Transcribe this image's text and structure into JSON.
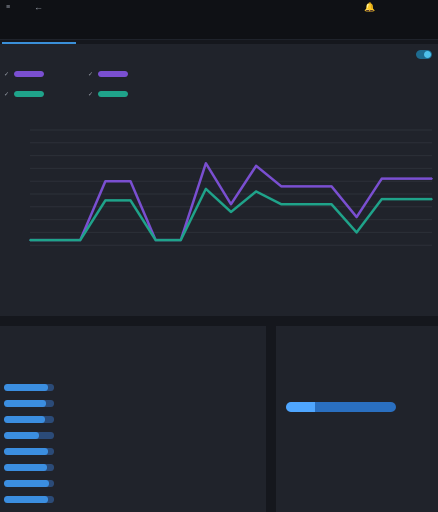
{
  "topbar": {
    "menu_text": "≡",
    "back_text": "←",
    "bell_text": "🔔",
    "right_line1": "",
    "right_line2": "",
    "bell_color": "#9aa0aa"
  },
  "tabs": {
    "active_label": ""
  },
  "chart_section": {
    "legend": {
      "col1_header": "",
      "col2_header": "",
      "toggle_label": ""
    },
    "footnote": ""
  },
  "chart_data": {
    "type": "line",
    "title": "",
    "x": [
      "",
      "",
      "",
      "",
      "",
      "",
      "",
      "",
      "",
      "",
      "",
      "",
      "",
      ""
    ],
    "series": [
      {
        "color": "#7a4fd1",
        "values": [
          14,
          14,
          14,
          60,
          60,
          14,
          14,
          74,
          42,
          72,
          56,
          56,
          56,
          32,
          62,
          62,
          62
        ]
      },
      {
        "color": "#1fa38a",
        "values": [
          14,
          14,
          14,
          45,
          45,
          14,
          14,
          54,
          36,
          52,
          42,
          42,
          42,
          20,
          46,
          46,
          46
        ]
      }
    ],
    "ylim": [
      0,
      100
    ],
    "grid": true,
    "legend_position": "top-left"
  },
  "apps_panel": {
    "title": "",
    "columns": [
      "",
      "",
      ""
    ],
    "rows": [
      {
        "fraction": 0.88,
        "c1": "",
        "c2": "",
        "c3": ""
      },
      {
        "fraction": 0.84,
        "c1": "",
        "c2": "",
        "c3": ""
      },
      {
        "fraction": 0.82,
        "c1": "",
        "c2": "",
        "c3": ""
      },
      {
        "fraction": 0.7,
        "c1": "",
        "c2": "",
        "c3": ""
      },
      {
        "fraction": 0.88,
        "c1": "",
        "c2": "",
        "c3": ""
      },
      {
        "fraction": 0.86,
        "c1": "",
        "c2": "",
        "c3": ""
      },
      {
        "fraction": 0.9,
        "c1": "",
        "c2": "",
        "c3": ""
      },
      {
        "fraction": 0.88,
        "c1": "",
        "c2": "",
        "c3": ""
      },
      {
        "fraction": 0.86,
        "c1": "",
        "c2": "",
        "c3": ""
      }
    ]
  },
  "storage_panel": {
    "title": "",
    "label": "",
    "percent_text": "",
    "fill_fraction": 0.26,
    "used_text": "",
    "devices_header": "",
    "devices": [
      "",
      ""
    ]
  }
}
